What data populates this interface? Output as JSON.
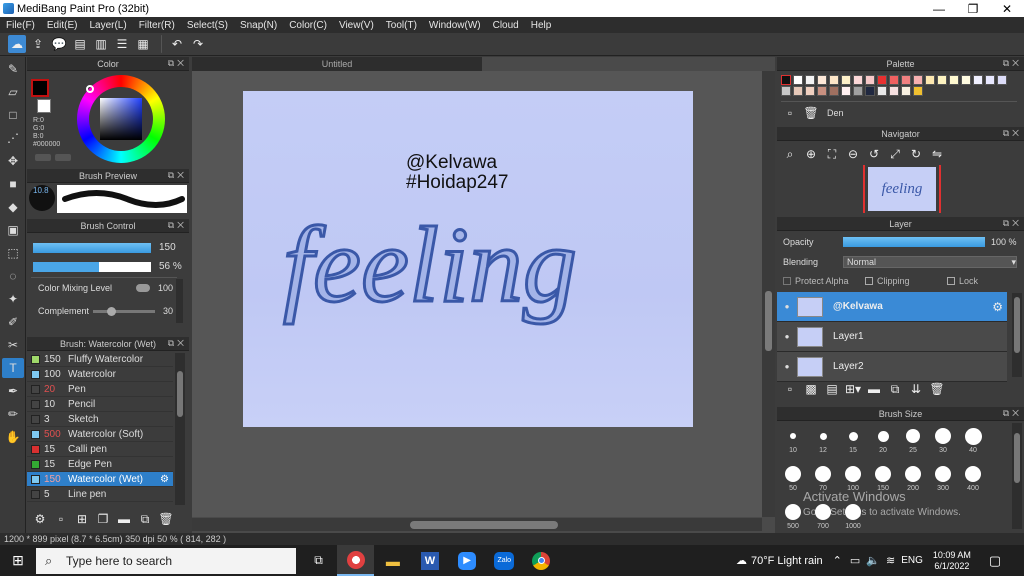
{
  "window": {
    "title": "MediBang Paint Pro (32bit)",
    "minimize": "—",
    "maximize": "❐",
    "close": "✕"
  },
  "menu": [
    "File(F)",
    "Edit(E)",
    "Layer(L)",
    "Filter(R)",
    "Select(S)",
    "Snap(N)",
    "Color(C)",
    "View(V)",
    "Tool(T)",
    "Window(W)",
    "Cloud",
    "Help"
  ],
  "color_panel": {
    "title": "Color",
    "r": "R:0",
    "g": "G:0",
    "b": "B:0",
    "hex": "#000000",
    "fg": "#000000",
    "accent": "#c01010"
  },
  "brush_preview": {
    "title": "Brush Preview",
    "size": "10.8"
  },
  "brush_control": {
    "title": "Brush Control",
    "size_value": "150",
    "opacity_value": "56 %",
    "mixing_label": "Color Mixing Level",
    "mixing_value": "100",
    "complement_label": "Complement",
    "complement_value": "30"
  },
  "brush_list": {
    "title": "Brush: Watercolor (Wet)",
    "items": [
      {
        "num": "150",
        "name": "Fluffy Watercolor",
        "color": "#9fd86a",
        "num_color": "#dddddd"
      },
      {
        "num": "100",
        "name": "Watercolor",
        "color": "#7ec8f0",
        "num_color": "#dddddd"
      },
      {
        "num": "20",
        "name": "Pen",
        "color": "#444444",
        "num_color": "#e05050"
      },
      {
        "num": "10",
        "name": "Pencil",
        "color": "#444444",
        "num_color": "#dddddd"
      },
      {
        "num": "3",
        "name": "Sketch",
        "color": "#444444",
        "num_color": "#dddddd"
      },
      {
        "num": "500",
        "name": "Watercolor (Soft)",
        "color": "#7ec8f0",
        "num_color": "#e05050"
      },
      {
        "num": "15",
        "name": "Calli pen",
        "color": "#d83030",
        "num_color": "#dddddd"
      },
      {
        "num": "15",
        "name": "Edge Pen",
        "color": "#33aa33",
        "num_color": "#dddddd"
      },
      {
        "num": "150",
        "name": "Watercolor (Wet)",
        "color": "#7ec8f0",
        "num_color": "#f0a0a0"
      },
      {
        "num": "5",
        "name": "Line pen",
        "color": "#444444",
        "num_color": "#dddddd"
      }
    ]
  },
  "document": {
    "tab": "Untitled",
    "line1": "@Kelvawa",
    "line2": "#Hoidap247",
    "artwork_text": "feeling"
  },
  "palette": {
    "title": "Palette",
    "set_name": "Den",
    "row1": [
      "#111111",
      "#ffffff",
      "#f3f3f3",
      "#fde8d8",
      "#fde6c8",
      "#fdf0c8",
      "#fbd7d7",
      "#f6c8c8",
      "#e83030",
      "#f06060",
      "#f08080",
      "#f6b0b0",
      "#fde8b0",
      "#fdf3c0",
      "#fff9d0",
      "#fffbe0",
      "#f0f0ff",
      "#e8e8ff",
      "#dcdcf8"
    ],
    "row2": [
      "#c8c8c8",
      "#e6c8b8",
      "#f0d0c0",
      "#c89080",
      "#a07060",
      "#fff0f0",
      "#a0a0a0",
      "#202840",
      "#e8e8e8",
      "#f6e0e0",
      "#f8f0e0",
      "#f0c030"
    ]
  },
  "navigator": {
    "title": "Navigator",
    "thumb_text": "feeling"
  },
  "layer_panel": {
    "title": "Layer",
    "opacity_label": "Opacity",
    "opacity_value": "100 %",
    "blending_label": "Blending",
    "blending_value": "Normal",
    "protect_alpha": "Protect Alpha",
    "clipping": "Clipping",
    "lock": "Lock",
    "layers": [
      {
        "name": "@Kelvawa",
        "selected": true
      },
      {
        "name": "Layer1",
        "selected": false
      },
      {
        "name": "Layer2",
        "selected": false
      }
    ]
  },
  "brush_size": {
    "title": "Brush Size",
    "sizes": [
      "10",
      "12",
      "15",
      "20",
      "25",
      "30",
      "40",
      "50",
      "70",
      "100",
      "150",
      "200",
      "300",
      "400",
      "500",
      "700",
      "1000"
    ]
  },
  "activation": {
    "line1": "Activate Windows",
    "line2": "Go to Settings to activate Windows."
  },
  "status": {
    "text": "1200 * 899 pixel  (8.7 * 6.5cm)  350 dpi  50 %  ( 814, 282 )"
  },
  "taskbar": {
    "search_placeholder": "Type here to search",
    "weather": "70°F  Light rain",
    "lang": "ENG",
    "time": "10:09 AM",
    "date": "6/1/2022",
    "zalo": "Zalo"
  }
}
